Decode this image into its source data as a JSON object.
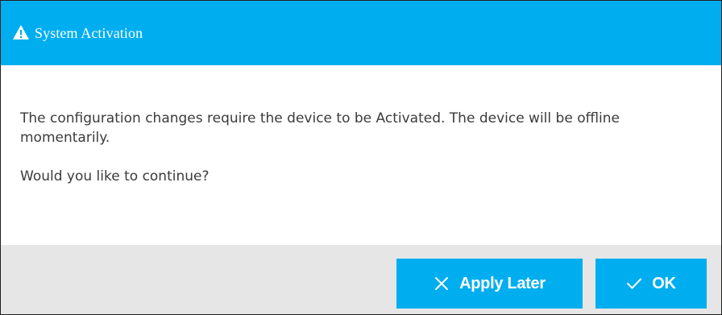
{
  "dialog": {
    "title": "System Activation",
    "title_icon": "warning-icon",
    "message": "The configuration changes require the device to be Activated. The device will be offline momentarily.",
    "question": "Would you like to continue?"
  },
  "buttons": {
    "apply_later": {
      "label": "Apply Later",
      "icon": "close-icon"
    },
    "ok": {
      "label": "OK",
      "icon": "check-icon"
    }
  },
  "colors": {
    "accent": "#00aef0",
    "footer_bg": "#e6e6e6",
    "text": "#3b3b3b"
  }
}
